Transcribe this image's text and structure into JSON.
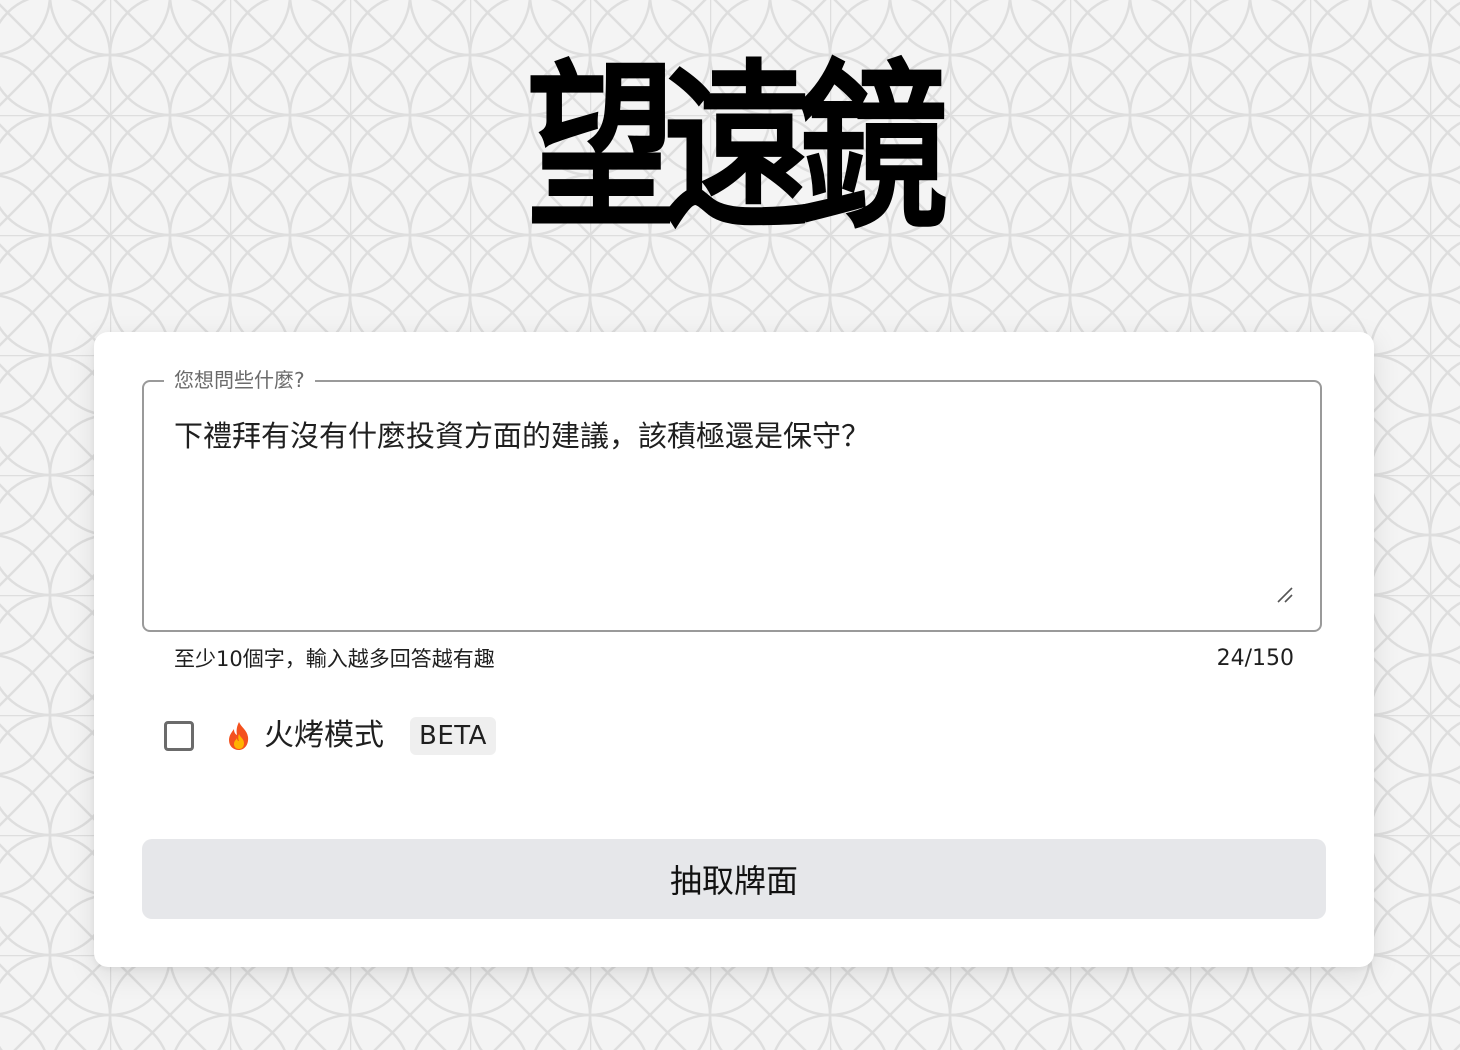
{
  "app": {
    "logo_text": "望遠鏡"
  },
  "question": {
    "label": "您想問些什麼?",
    "value": "下禮拜有沒有什麼投資方面的建議，該積極還是保守？",
    "helper": "至少10個字，輸入越多回答越有趣",
    "count": "24/150"
  },
  "roast_mode": {
    "label": "火烤模式",
    "badge": "BETA",
    "checked": false,
    "icon": "fire-icon"
  },
  "actions": {
    "draw_label": "抽取牌面"
  },
  "colors": {
    "background": "#f4f4f4",
    "pattern_line": "#dedede",
    "card": "#ffffff",
    "button": "#e6e7ea",
    "field_border": "#9a9a9a"
  }
}
